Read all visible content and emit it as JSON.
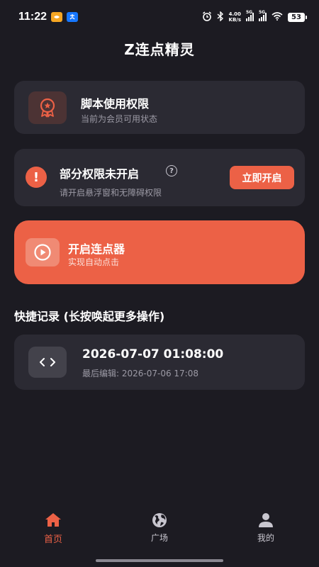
{
  "status_bar": {
    "time": "11:22",
    "net_speed_value": "4.00",
    "net_speed_unit": "KB/s",
    "signal_1_label": "5G",
    "signal_2_label": "5G",
    "battery": "53"
  },
  "header": {
    "title": "Z连点精灵"
  },
  "permission_card": {
    "title": "脚本使用权限",
    "subtitle": "当前为会员可用状态"
  },
  "warning_card": {
    "title": "部分权限未开启",
    "subtitle": "请开启悬浮窗和无障碍权限",
    "button_label": "立即开启",
    "help_glyph": "?"
  },
  "start_card": {
    "title": "开启连点器",
    "subtitle": "实现自动点击"
  },
  "quick_records": {
    "section_title": "快捷记录 (长按唤起更多操作)",
    "items": [
      {
        "name": "2026-07-07 01:08:00",
        "last_edit": "最后编辑: 2026-07-06 17:08"
      }
    ]
  },
  "tabbar": {
    "items": [
      {
        "label": "首页",
        "icon": "home-icon",
        "active": true
      },
      {
        "label": "广场",
        "icon": "globe-icon",
        "active": false
      },
      {
        "label": "我的",
        "icon": "person-icon",
        "active": false
      }
    ]
  },
  "colors": {
    "background": "#1c1b22",
    "card": "#2b2a33",
    "accent": "#ec6146",
    "muted_text": "#9c9aa5"
  }
}
